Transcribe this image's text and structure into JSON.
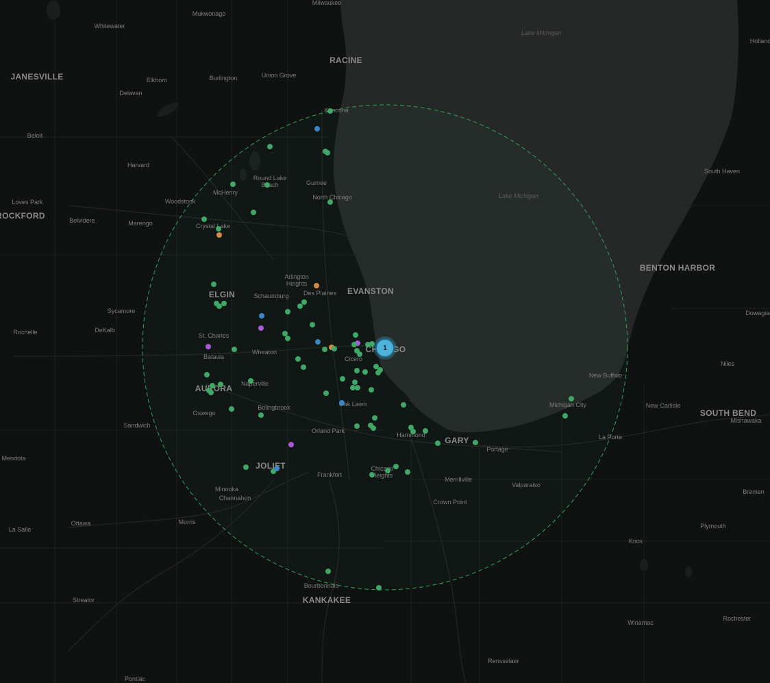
{
  "map": {
    "water_labels": [
      "Lake Michigan",
      "Lake Michigan"
    ],
    "city_labels": [
      "Milwaukee",
      "Mukwonago",
      "Whitewater",
      "Holland",
      "RACINE",
      "JANESVILLE",
      "Union Grove",
      "Burlington",
      "Elkhorn",
      "Delavan",
      "Kenosha",
      "Beloit",
      "Harvard",
      "Round Lake Beach",
      "Gurnee",
      "South Haven",
      "McHenry",
      "Loves Park",
      "Woodstock",
      "North Chicago",
      "ROCKFORD",
      "Belvidere",
      "Marengo",
      "Crystal Lake",
      "BENTON HARBOR",
      "Arlington Heights",
      "Des Plaines",
      "EVANSTON",
      "ELGIN",
      "Schaumburg",
      "Dowagiac",
      "Sycamore",
      "Rochelle",
      "DeKalb",
      "St. Charles",
      "Batavia",
      "Wheaton",
      "CHICAGO",
      "Cicero",
      "Niles",
      "New Buffalo",
      "Naperville",
      "AURORA",
      "Oak Lawn",
      "Michigan City",
      "New Carlisle",
      "SOUTH BEND",
      "Mishawaka",
      "Bolingbrook",
      "Oswego",
      "Sandwich",
      "Orland Park",
      "Hammond",
      "GARY",
      "La Porte",
      "Mendota",
      "Portage",
      "JOLIET",
      "Frankfort",
      "Chicago Heights",
      "Merrillville",
      "Valparaiso",
      "Bremen",
      "Minooka",
      "Channahon",
      "Crown Point",
      "La Salle",
      "Ottawa",
      "Morris",
      "Plymouth",
      "Knox",
      "Bourbonnais",
      "Streator",
      "KANKAKEE",
      "Winamac",
      "Rochester",
      "Rensselaer",
      "Pontiac"
    ],
    "cluster": {
      "count": "1",
      "color": "#4fb3d9"
    },
    "radius_circle": {
      "stroke": "#2fa55a",
      "style": "dashed"
    },
    "marker_colors": {
      "green": "#3fa867",
      "blue": "#3a86c8",
      "purple": "#a958d8",
      "orange": "#d08a4a"
    }
  }
}
